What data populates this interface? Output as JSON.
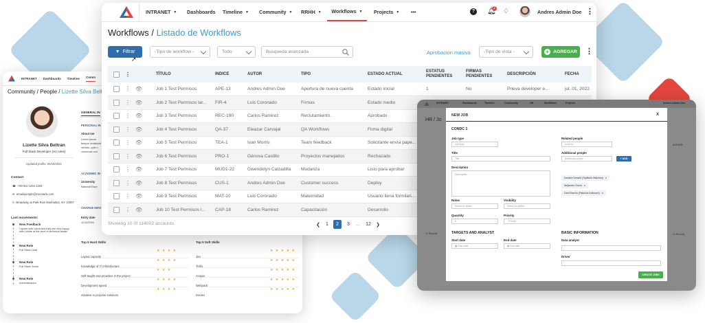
{
  "colors": {
    "accent": "#e5453f",
    "primary": "#2f6ea8",
    "link": "#3c9bd6",
    "success": "#47b04b",
    "decor_blue": "#b9d7e8"
  },
  "main": {
    "nav": {
      "intranet": "INTRANET",
      "dashboards": "Dashboards",
      "timeline": "Timeline",
      "community": "Community",
      "rrhh": "RRHH",
      "workflows": "Workflows",
      "projects": "Projects",
      "more": "•••",
      "user": "Andres Admin Doe",
      "notif_count": "2"
    },
    "title": "Workflows",
    "title_sep": " / ",
    "title_link": "Listado de Workflows",
    "toolbar": {
      "filter": "Filtrar",
      "workflow_type_placeholder": "-Tipo de workflow -",
      "all": "Todo",
      "search_placeholder": "Busqueda avanzada",
      "mass_approval": "Aprobacion masiva",
      "view_type": "-Tipo de vista -",
      "add": "AGREGAR"
    },
    "columns": [
      "TÍTULO",
      "INDICE",
      "AUTOR",
      "TIPO",
      "ESTADO ACTUAL",
      "ESTATUS PENDIENTES",
      "FIRMAS PENDIENTES",
      "DESCRIPCIÓN",
      "FECHA"
    ],
    "rows": [
      [
        "Job 1 Test Permisos",
        "APE-13",
        "Andres Admin Doe",
        "Apertura de nueva cuenta",
        "Estado inicial",
        "1",
        "No",
        "Prieva developer e...",
        "jul. 01, 2022"
      ],
      [
        "Job 2 Test Permisos lar...",
        "FIR-4",
        "Luis Coronado",
        "Firmas",
        "Estado medio",
        "",
        "",
        "",
        ""
      ],
      [
        "Job 3 Test Permisos",
        "REC-190",
        "Carlos Ramirez",
        "Reclutamiento.",
        "Aprobado",
        "",
        "",
        "",
        ""
      ],
      [
        "Job 4 Test Permisos",
        "QA-37",
        "Eleazar Carvajal",
        "QA Workflows",
        "Firma digital",
        "",
        "",
        "",
        ""
      ],
      [
        "Job 5 Test Permisos",
        "TEA-1",
        "Ivan Morris",
        "Team feedback",
        "Solicitante envía pape...",
        "",
        "",
        "",
        ""
      ],
      [
        "Job 6 Test Permisos",
        "PRO-1",
        "Génova Castillo",
        "Proyectos manejados",
        "Rechazado",
        "",
        "",
        "",
        ""
      ],
      [
        "Job 7 Test Permisos",
        "MUD1-22",
        "Gwendolyn Calzadilla",
        "Mudanza",
        "Listo para aprobar",
        "",
        "",
        "",
        ""
      ],
      [
        "Job 8 Test Permisos",
        "CUS-1",
        "Andres Admin Doe",
        "Customer success",
        "Deploy",
        "",
        "",
        "",
        ""
      ],
      [
        "Job 9 Test Permisos",
        "MAT-10",
        "Luis Coronado",
        "Maternidad",
        "Usuario llena formilari...",
        "",
        "",
        "",
        ""
      ],
      [
        "Job 10 Test Permisos l...",
        "CAP-18",
        "Carlos Ramirez",
        "Capacitación",
        "Desarrollo",
        "",
        "",
        "",
        ""
      ]
    ],
    "footer": "Showing 10 0f 114002 accounts",
    "pagination": [
      "1",
      "2",
      "3",
      "...",
      "12"
    ]
  },
  "profile": {
    "nav": [
      "INTRANET",
      "Dashboards",
      "Timeline",
      "Comm"
    ],
    "breadcrumb": "Community / People / ",
    "breadcrumb_link": "Lizette Silva Beltran",
    "name": "Lizette Silva Beltran",
    "role": "Full Stack Developer (H2 roles)",
    "updated": "Updated profile: 05/16/2021",
    "contact_title": "Contact:",
    "phone": "+59 911 1234 1234",
    "email": "emailejemplo@zocotack.com",
    "address": "Broadway at Park Row Manhattan, NY 10007",
    "movements_title": "Last movements:",
    "movements": [
      {
        "title": "New Feedback",
        "text": "I spoke with Laura and they are very happy with Lizette at the level of technical leader"
      },
      {
        "title": "New Role",
        "text": "Full Stack Lead"
      },
      {
        "title": "New Role",
        "text": "Full Stack Junior"
      },
      {
        "title": "New Role",
        "text": "Administración"
      }
    ],
    "tab": "GENERAL IN",
    "personal": "PERSONAL IN",
    "about": "About me",
    "about_text": "Lorem ipsum tempor incididunt veniam, quis n commodo con",
    "academic": "ACADEMIC IN",
    "university": "University",
    "university_text": "National Expe",
    "charge": "CHARGE INFO",
    "entry": "Entry date",
    "entry_date": "11/12/2016",
    "hard_title": "Top 5 Hard Skills",
    "soft_title": "Top 5 Soft Skills",
    "hard": [
      "Layout capacity",
      "Knowledge of IT infrastructure",
      "Self-taught and proactive in the project",
      "Development speed",
      "Initiative to propose solutions"
    ],
    "soft": [
      "Jira",
      "Trello",
      "Acopia",
      "Webpack",
      "Docker"
    ],
    "hard_stars": [
      "★ ★ ★ ★",
      "★ ★ ★ ★",
      "★ ★ ★",
      "★ ★ ★ ★",
      "★ ★ ★ ★"
    ],
    "soft_stars": [
      "★ ★ ★ ★ ★",
      "★ ★ ★ ★ ★",
      "★ ★ ★ ★ ★",
      "★ ★ ★ ★ ★",
      "★ ★ ★ ★ ★"
    ]
  },
  "modal_window": {
    "nav": {
      "intranet": "INTRANET",
      "dashboards": "Dashboards",
      "timeline": "Timeline",
      "community": "Community",
      "rrhh": "HR",
      "workflows": "Workflows",
      "projects": "Projects",
      "user": "Andres Admin Doe"
    },
    "page_title": "HR / Jo",
    "side_col": "AUTHOR",
    "footer": "10 Records",
    "modal": {
      "title": "NEW JOB",
      "close": "X",
      "section": "CONDC 1",
      "job_type": "Job type",
      "job_type_ph": "Add type",
      "title_lbl": "Title",
      "title_ph": "Title",
      "description": "Description",
      "description_ph": "Description",
      "related": "Related people",
      "related_ph": "Look for",
      "additional": "Additional people",
      "additional_ph": "Additional people",
      "add": "ADD",
      "chips": [
        "Daniela Geraldi (TopBank Watches)",
        "Alejandro Osoro",
        "Dani Bracho (Palacios Inaboom)"
      ],
      "roles": "Roles",
      "roles_ph": "Select an option",
      "visibility": "Visibility",
      "visibility_ph": "Select an option",
      "quantity": "Quantity",
      "quantity_val": "0",
      "priority": "Priority",
      "priority_ph": "- Priority",
      "targets": "TARGETS AND ANALYST",
      "basic": "BASIC INFORMATION",
      "start": "Start date",
      "start_ph": "Start date",
      "end": "End date",
      "end_ph": "End date",
      "analyst": "Data analyst",
      "driver": "Driver",
      "create": "CREATE JOBS"
    }
  }
}
